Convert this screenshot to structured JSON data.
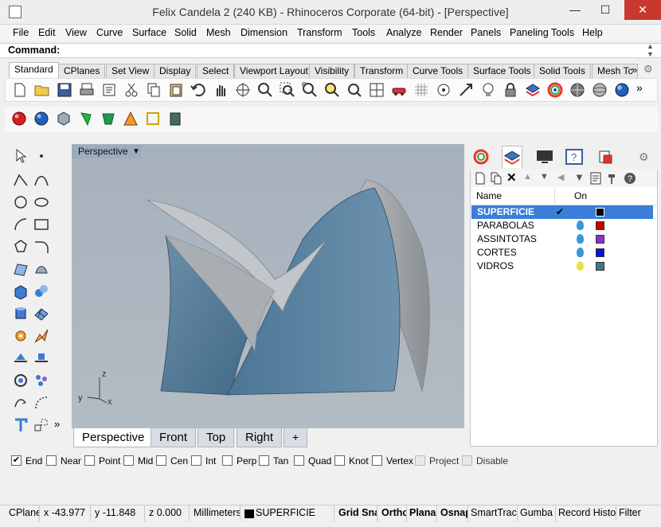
{
  "window": {
    "title": "Felix Candela 2 (240 KB) - Rhinoceros Corporate (64-bit) - [Perspective]",
    "min_glyph": "—",
    "max_glyph": "☐",
    "close_glyph": "✕"
  },
  "menu": [
    "File",
    "Edit",
    "View",
    "Curve",
    "Surface",
    "Solid",
    "Mesh",
    "Dimension",
    "Transform",
    "Tools",
    "Analyze",
    "Render",
    "Panels",
    "Paneling Tools",
    "Help"
  ],
  "command": {
    "label": "Command:",
    "value": ""
  },
  "toolbar_tabs": [
    "Standard",
    "CPlanes",
    "Set View",
    "Display",
    "Select",
    "Viewport Layout",
    "Visibility",
    "Transform",
    "Curve Tools",
    "Surface Tools",
    "Solid Tools",
    "Mesh Tc"
  ],
  "toolbar_tabs_overflow": "»",
  "viewport": {
    "title": "Perspective",
    "axes": {
      "z": "z",
      "y": "y",
      "x": "x"
    }
  },
  "viewport_tabs": [
    "Perspective",
    "Front",
    "Top",
    "Right"
  ],
  "add_tab_glyph": "+",
  "layers": {
    "header_name": "Name",
    "header_on": "On",
    "rows": [
      {
        "name": "SUPERFICIE",
        "current": true,
        "color": "#000000",
        "bulb": "check"
      },
      {
        "name": "PARABOLAS",
        "current": false,
        "color": "#cc0000",
        "bulb": "#3399dd"
      },
      {
        "name": "ASSINTOTAS",
        "current": false,
        "color": "#8833cc",
        "bulb": "#3399dd"
      },
      {
        "name": "CORTES",
        "current": false,
        "color": "#1010dd",
        "bulb": "#3399dd"
      },
      {
        "name": "VIDROS",
        "current": false,
        "color": "#3a7a8a",
        "bulb": "#e8e24a"
      }
    ]
  },
  "osnaps": [
    {
      "label": "End",
      "checked": true
    },
    {
      "label": "Near",
      "checked": false
    },
    {
      "label": "Point",
      "checked": false
    },
    {
      "label": "Mid",
      "checked": false
    },
    {
      "label": "Cen",
      "checked": false
    },
    {
      "label": "Int",
      "checked": false
    },
    {
      "label": "Perp",
      "checked": false
    },
    {
      "label": "Tan",
      "checked": false
    },
    {
      "label": "Quad",
      "checked": false
    },
    {
      "label": "Knot",
      "checked": false
    },
    {
      "label": "Vertex",
      "checked": false
    },
    {
      "label": "Project",
      "checked": false,
      "disabled": true
    },
    {
      "label": "Disable",
      "checked": false,
      "disabled": true
    }
  ],
  "status": {
    "cplane": "CPlane",
    "x": "x -43.977",
    "y": "y -11.848",
    "z": "z 0.000",
    "units": "Millimeters",
    "layer": "SUPERFICIE",
    "grid_snap": "Grid Sna",
    "ortho": "Ortho",
    "planar": "Plana",
    "osnap": "Osnap",
    "smarttrack": "SmartTrac",
    "gumball": "Gumba",
    "record_history": "Record Histo",
    "filter": "Filter"
  }
}
